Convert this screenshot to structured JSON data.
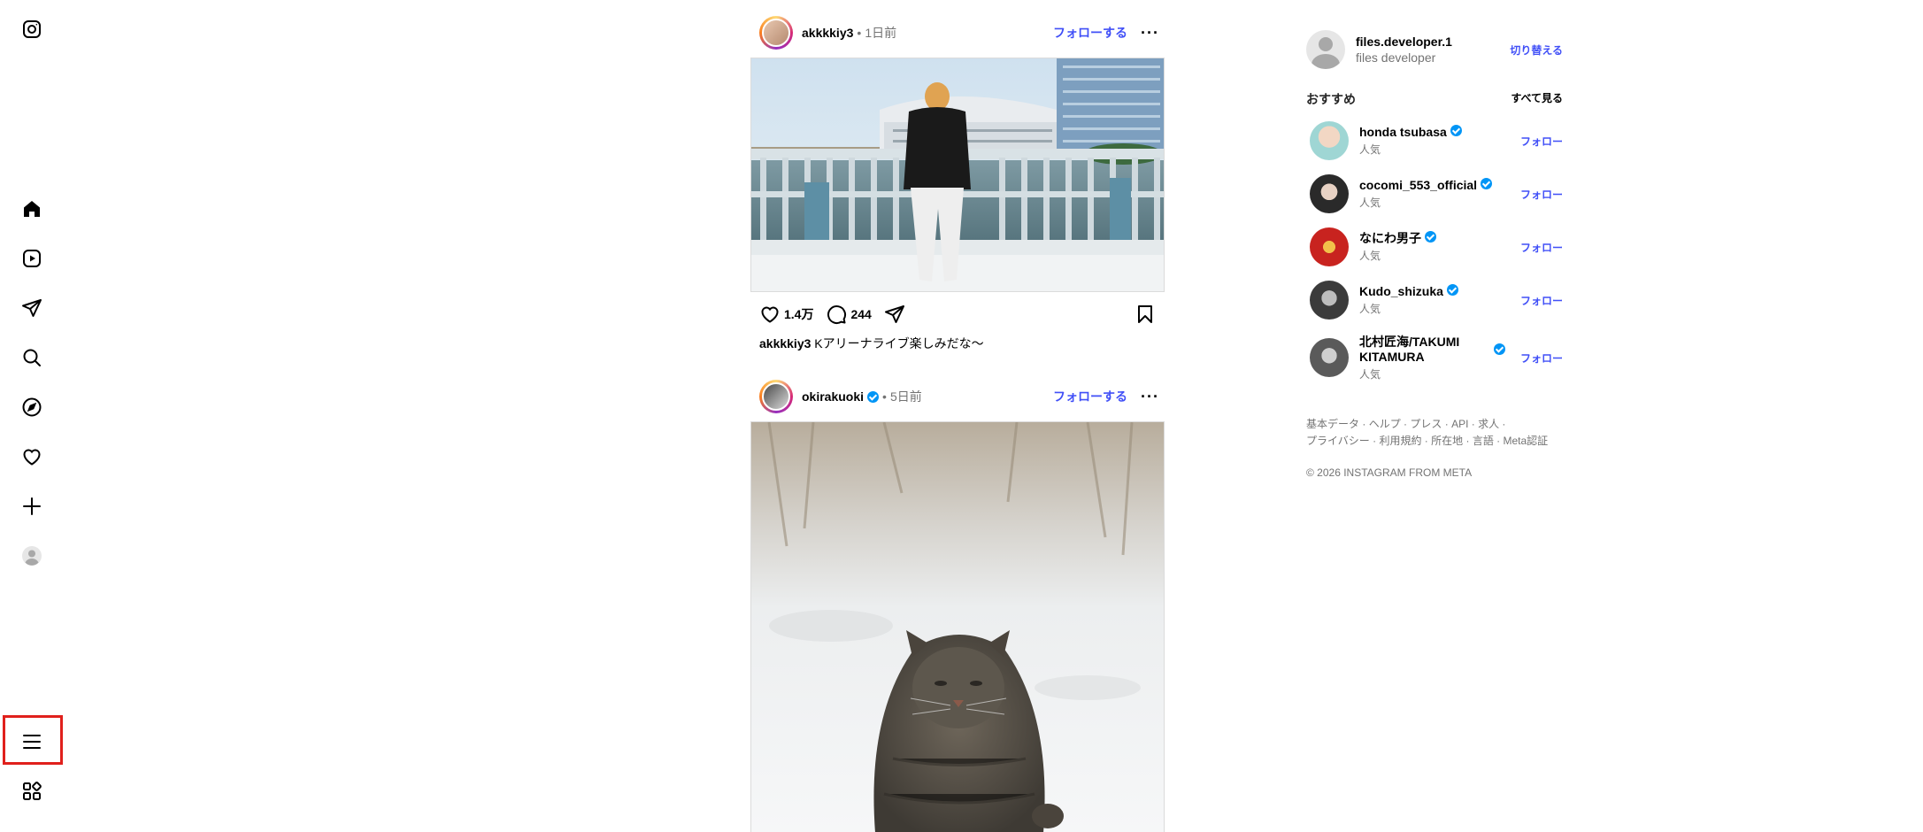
{
  "nav": {
    "items": [
      {
        "name": "instagram-logo-icon"
      },
      {
        "name": "home-icon"
      },
      {
        "name": "reels-icon"
      },
      {
        "name": "messages-icon"
      },
      {
        "name": "search-icon"
      },
      {
        "name": "explore-icon"
      },
      {
        "name": "notifications-icon"
      },
      {
        "name": "create-icon"
      },
      {
        "name": "profile-icon"
      },
      {
        "name": "menu-icon"
      },
      {
        "name": "more-apps-icon"
      }
    ],
    "highlight_color": "#e0201c"
  },
  "posts": [
    {
      "username": "akkkkiy3",
      "verified": false,
      "time": "1日前",
      "follow_label": "フォローする",
      "likes": "1.4万",
      "comments": "244",
      "caption_user": "akkkkiy3",
      "caption_text": "Kアリーナライブ楽しみだな〜"
    },
    {
      "username": "okirakuoki",
      "verified": true,
      "time": "5日前",
      "follow_label": "フォローする"
    }
  ],
  "sidebar": {
    "me": {
      "username": "files.developer.1",
      "full_name": "files developer",
      "switch_label": "切り替える"
    },
    "suggestions_title": "おすすめ",
    "see_all_label": "すべて見る",
    "suggestions": [
      {
        "name": "honda tsubasa",
        "sub": "人気",
        "follow": "フォロー",
        "color": "#9fd6d4"
      },
      {
        "name": "cocomi_553_official",
        "sub": "人気",
        "follow": "フォロー",
        "color": "#2a2a2a"
      },
      {
        "name": "なにわ男子",
        "sub": "人気",
        "follow": "フォロー",
        "color": "#c8231f"
      },
      {
        "name": "Kudo_shizuka",
        "sub": "人気",
        "follow": "フォロー",
        "color": "#3b3b3b"
      },
      {
        "name": "北村匠海/TAKUMI KITAMURA",
        "sub": "人気",
        "follow": "フォロー",
        "color": "#5a5a5a"
      }
    ],
    "footer": {
      "line1": [
        "基本データ",
        "ヘルプ",
        "プレス",
        "API",
        "求人"
      ],
      "line2": [
        "プライバシー",
        "利用規約",
        "所在地",
        "言語",
        "Meta認証"
      ],
      "copyright": "© 2026 INSTAGRAM FROM META"
    }
  },
  "colors": {
    "accent": "#4150f7",
    "verified": "#0095f6",
    "muted": "#737373"
  }
}
